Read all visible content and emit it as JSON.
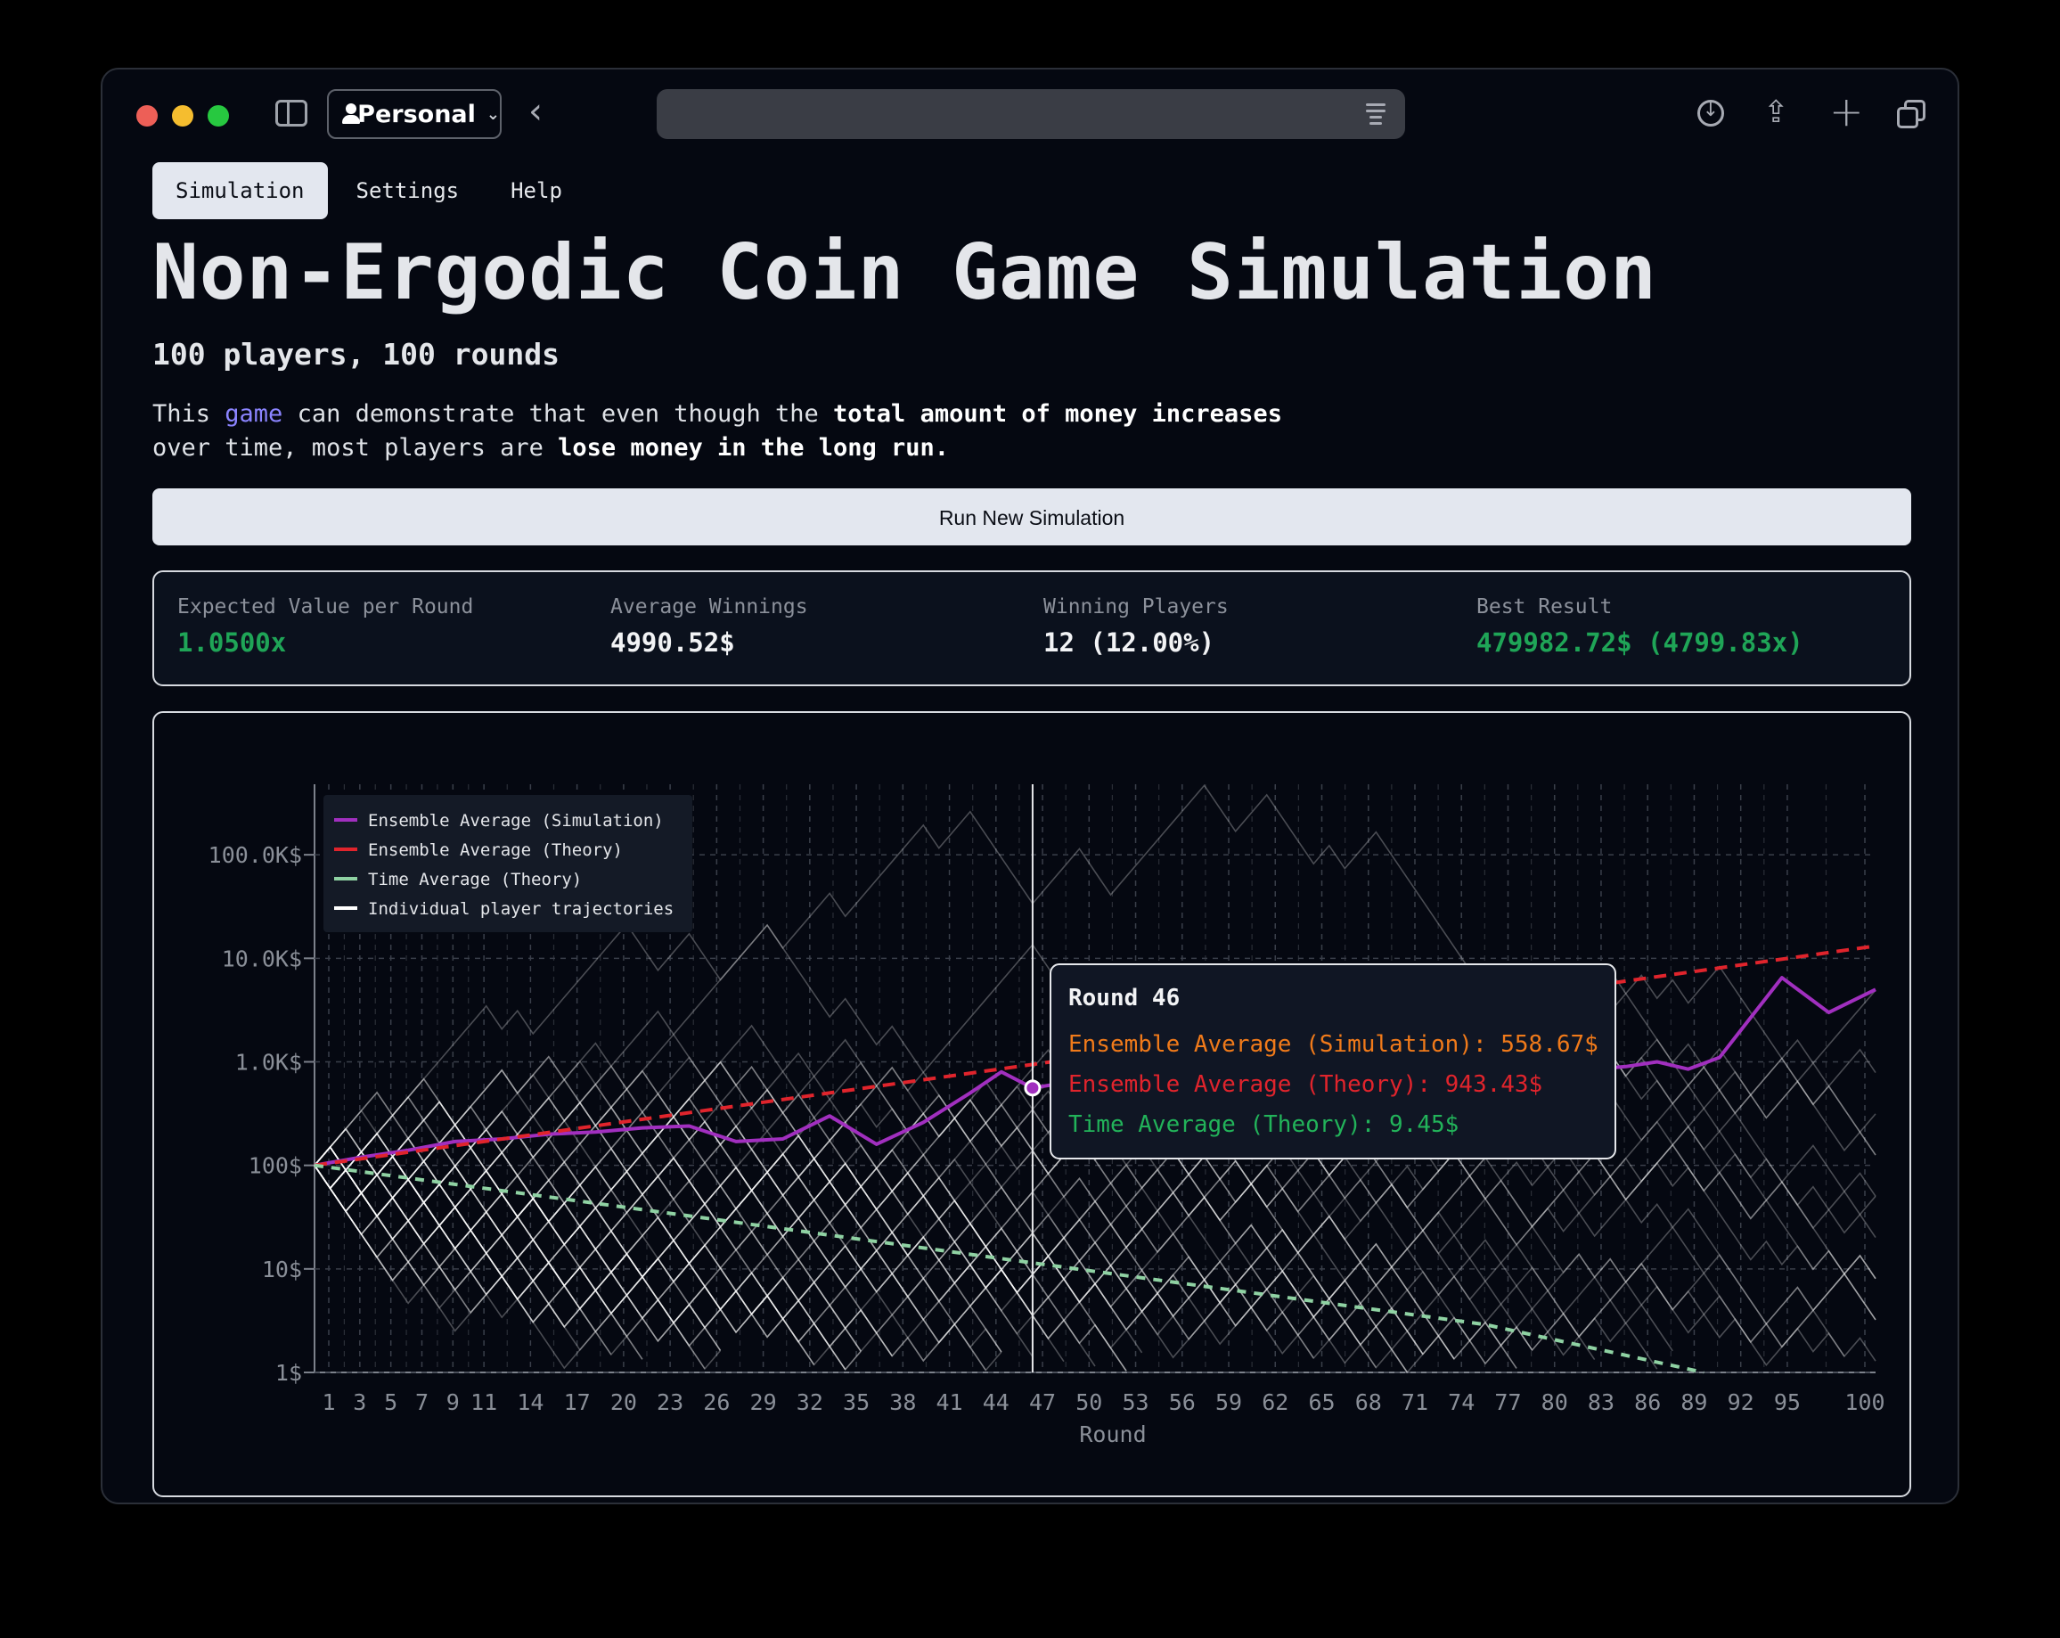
{
  "toolbar": {
    "profile_label": "Personal"
  },
  "nav": {
    "tabs": [
      {
        "label": "Simulation",
        "active": true
      },
      {
        "label": "Settings",
        "active": false
      },
      {
        "label": "Help",
        "active": false
      }
    ]
  },
  "page": {
    "title": "Non-Ergodic Coin Game Simulation",
    "subtitle": "100 players, 100 rounds",
    "desc_1": "This ",
    "desc_link": "game",
    "desc_2": " can demonstrate that even though the ",
    "desc_bold_1": "total amount of money increases",
    "desc_3": " over time, most players are ",
    "desc_bold_2": "lose money in the long run.",
    "run_button": "Run New Simulation"
  },
  "stats": [
    {
      "label": "Expected Value per Round",
      "value": "1.0500x",
      "color": "#1fa557"
    },
    {
      "label": "Average Winnings",
      "value": "4990.52$",
      "color": "#f2f3f5"
    },
    {
      "label": "Winning Players",
      "value": "12 (12.00%)",
      "color": "#f2f3f5"
    },
    {
      "label": "Best Result",
      "value": "479982.72$ (4799.83x)",
      "color": "#1fa557"
    }
  ],
  "colors": {
    "ensemble_sim": "#a12fbf",
    "ensemble_theory": "#e0242c",
    "time_theory": "#8fd2a3",
    "individual": "#ffffff",
    "tooltip_orange": "#f07a1a",
    "tooltip_red": "#e0242c",
    "tooltip_green": "#22b35a"
  },
  "chart_data": {
    "type": "line",
    "xlabel": "Round",
    "y_scale": "log",
    "ylim": [
      1,
      480000
    ],
    "x_tick_labels": [
      "1",
      "3",
      "5",
      "7",
      "9",
      "11",
      "14",
      "17",
      "20",
      "23",
      "26",
      "29",
      "32",
      "35",
      "38",
      "41",
      "44",
      "47",
      "50",
      "53",
      "56",
      "59",
      "62",
      "65",
      "68",
      "71",
      "74",
      "77",
      "80",
      "83",
      "86",
      "89",
      "92",
      "95",
      "100"
    ],
    "y_tick_labels": [
      "1$",
      "10$",
      "100$",
      "1.0K$",
      "10.0K$",
      "100.0K$"
    ],
    "y_tick_values": [
      1,
      10,
      100,
      1000,
      10000,
      100000
    ],
    "legend_position": "top-left",
    "series": [
      {
        "name": "Ensemble Average (Simulation)",
        "color": "#a12fbf",
        "x": [
          0,
          3,
          6,
          9,
          12,
          15,
          18,
          21,
          24,
          27,
          30,
          33,
          36,
          39,
          42,
          44,
          46,
          50,
          54,
          58,
          62,
          66,
          70,
          74,
          78,
          82,
          84,
          86,
          88,
          90,
          94,
          97,
          100
        ],
        "values": [
          100,
          120,
          140,
          170,
          180,
          200,
          210,
          230,
          240,
          170,
          180,
          300,
          160,
          260,
          500,
          800,
          559,
          700,
          650,
          900,
          800,
          1300,
          700,
          1800,
          1200,
          850,
          900,
          1000,
          850,
          1100,
          6500,
          3000,
          5000
        ]
      },
      {
        "name": "Ensemble Average (Theory)",
        "color": "#e0242c",
        "x": [
          0,
          25,
          50,
          75,
          100
        ],
        "values": [
          100,
          339,
          1147,
          3883,
          13150
        ]
      },
      {
        "name": "Time Average (Theory)",
        "color": "#8fd2a3",
        "x": [
          0,
          25,
          50,
          75,
          89
        ],
        "values": [
          100,
          31,
          9.45,
          2.9,
          1
        ]
      },
      {
        "name": "Individual player trajectories",
        "color": "#ffffff",
        "x": [],
        "values": []
      }
    ],
    "tooltip": {
      "title": "Round 46",
      "lines": [
        {
          "text": "Ensemble Average (Simulation): 558.67$",
          "color": "#f07a1a"
        },
        {
          "text": "Ensemble Average (Theory): 943.43$",
          "color": "#e0242c"
        },
        {
          "text": "Time Average (Theory): 9.45$",
          "color": "#22b35a"
        }
      ]
    },
    "hover_round": 46
  }
}
